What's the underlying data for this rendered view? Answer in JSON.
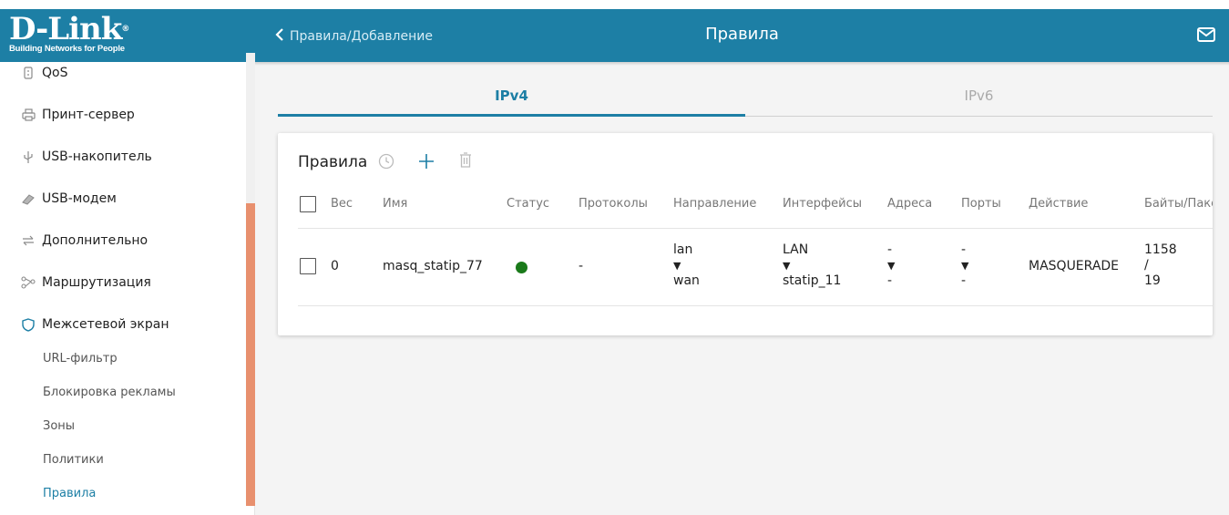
{
  "colors": {
    "brand": "#1d7fa5",
    "accent_scroll": "#e8906e",
    "status_on": "#1a7a1a"
  },
  "logo": {
    "brand": "D-Link",
    "trademark": "®",
    "tagline": "Building Networks for People"
  },
  "header": {
    "back_label": "Правила/Добавление",
    "title": "Правила",
    "mail_icon": "mail-icon"
  },
  "sidebar": {
    "items": [
      {
        "label": "QoS",
        "icon": "qos-icon"
      },
      {
        "label": "Принт-сервер",
        "icon": "printer-icon"
      },
      {
        "label": "USB-накопитель",
        "icon": "usb-icon"
      },
      {
        "label": "USB-модем",
        "icon": "modem-icon"
      },
      {
        "label": "Дополнительно",
        "icon": "arrows-icon"
      },
      {
        "label": "Маршрутизация",
        "icon": "routing-icon"
      },
      {
        "label": "Межсетевой экран",
        "icon": "shield-icon"
      }
    ],
    "subitems": [
      {
        "label": "URL-фильтр"
      },
      {
        "label": "Блокировка рекламы"
      },
      {
        "label": "Зоны"
      },
      {
        "label": "Политики"
      },
      {
        "label": "Правила"
      }
    ]
  },
  "tabs": [
    {
      "label": "IPv4"
    },
    {
      "label": "IPv6"
    }
  ],
  "card": {
    "title": "Правила"
  },
  "table": {
    "headers": [
      "Вес",
      "Имя",
      "Статус",
      "Протоколы",
      "Направление",
      "Интерфейсы",
      "Адреса",
      "Порты",
      "Действие",
      "Байты/Пакеты"
    ],
    "rows": [
      {
        "weight": "0",
        "name": "masq_statip_77",
        "status": "on",
        "protocols": "-",
        "direction": {
          "from": "lan",
          "arrow": "▼",
          "to": "wan"
        },
        "interfaces": {
          "from": "LAN",
          "arrow": "▼",
          "to": "statip_11"
        },
        "addresses": {
          "from": "-",
          "arrow": "▼",
          "to": "-"
        },
        "ports": {
          "from": "-",
          "arrow": "▼",
          "to": "-"
        },
        "action": "MASQUERADE",
        "bytes_packets": {
          "bytes": "1158",
          "sep": "/",
          "packets": "19"
        }
      }
    ]
  }
}
